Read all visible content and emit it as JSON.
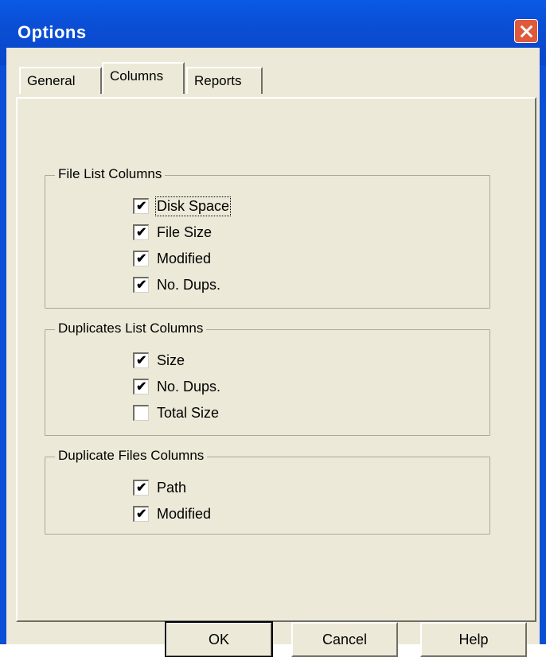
{
  "window": {
    "title": "Options"
  },
  "tabs": [
    {
      "label": "General"
    },
    {
      "label": "Columns"
    },
    {
      "label": "Reports"
    }
  ],
  "groups": {
    "file_list": {
      "title": "File List Columns",
      "items": [
        {
          "label": "Disk Space",
          "checked": true
        },
        {
          "label": "File Size",
          "checked": true
        },
        {
          "label": "Modified",
          "checked": true
        },
        {
          "label": "No. Dups.",
          "checked": true
        }
      ]
    },
    "duplicates_list": {
      "title": "Duplicates List Columns",
      "items": [
        {
          "label": "Size",
          "checked": true
        },
        {
          "label": "No. Dups.",
          "checked": true
        },
        {
          "label": "Total Size",
          "checked": false
        }
      ]
    },
    "duplicate_files": {
      "title": "Duplicate Files Columns",
      "items": [
        {
          "label": "Path",
          "checked": true
        },
        {
          "label": "Modified",
          "checked": true
        }
      ]
    }
  },
  "buttons": {
    "ok": "OK",
    "cancel": "Cancel",
    "help": "Help"
  }
}
